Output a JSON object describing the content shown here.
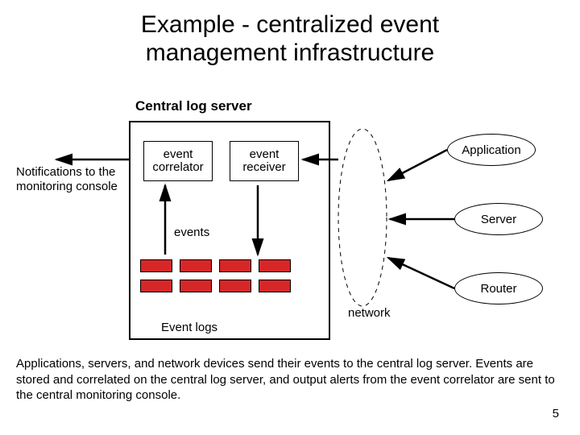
{
  "title_line1": "Example - centralized event",
  "title_line2": "management infrastructure",
  "subtitle": "Central log server",
  "correlator": "event correlator",
  "receiver": "event receiver",
  "events_label": "events",
  "eventlogs_label": "Event logs",
  "notifications": "Notifications to the monitoring console",
  "network_label": "network",
  "ellipses": {
    "app": "Application",
    "server": "Server",
    "router": "Router"
  },
  "footer": "Applications, servers, and network devices send their events to the central log server. Events are stored and correlated on the central log server, and output alerts from the event correlator are sent to the central monitoring console.",
  "page": "5",
  "log_grid": {
    "rows": 2,
    "cols": 4
  },
  "colors": {
    "log_cell": "#d62728"
  }
}
